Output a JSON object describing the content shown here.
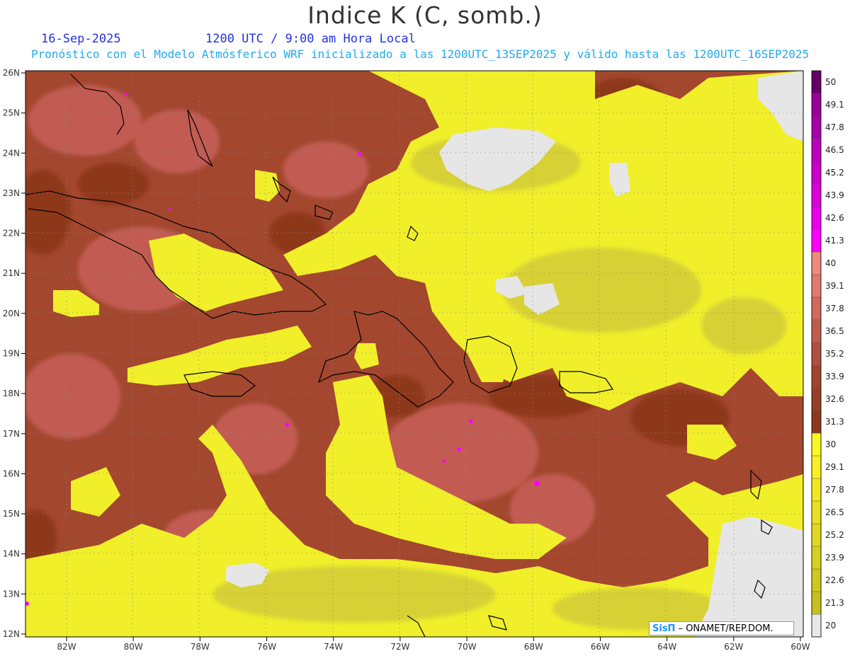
{
  "title": "Indice K (C, somb.)",
  "date": "16-Sep-2025",
  "time_label": "1200 UTC / 9:00 am Hora Local",
  "description": "Pronóstico con el Modelo Atmósferico WRF inicializado a las 1200UTC_13SEP2025 y válido hasta las  1200UTC_16SEP2025",
  "credit": {
    "brand": "SisΠ",
    "text": " – ONAMET/REP.DOM."
  },
  "lat_labels": [
    "12N",
    "13N",
    "14N",
    "15N",
    "16N",
    "17N",
    "18N",
    "19N",
    "20N",
    "21N",
    "22N",
    "23N",
    "24N",
    "25N",
    "26N"
  ],
  "lon_labels": [
    "82W",
    "80W",
    "78W",
    "76W",
    "74W",
    "72W",
    "70W",
    "68W",
    "66W",
    "64W",
    "62W",
    "60W"
  ],
  "colorbar": {
    "labels": [
      "20",
      "21.3",
      "22.6",
      "23.9",
      "25.2",
      "26.5",
      "27.8",
      "29.1",
      "30",
      "31.3",
      "32.6",
      "33.9",
      "35.2",
      "36.5",
      "37.8",
      "39.1",
      "40",
      "41.3",
      "42.6",
      "43.9",
      "45.2",
      "46.5",
      "47.8",
      "49.1",
      "50"
    ],
    "colors": [
      "#e8e8e8",
      "#c8c020",
      "#d0c820",
      "#d8d020",
      "#e0d820",
      "#e8e020",
      "#f0e820",
      "#f8f020",
      "#f8f820",
      "#8b3a1a",
      "#963f22",
      "#a0462c",
      "#b05040",
      "#c05c4c",
      "#d06a5c",
      "#e07a6c",
      "#ee8a7c",
      "#ff00ff",
      "#ee00ee",
      "#dd00dd",
      "#cc00cc",
      "#bb00bb",
      "#aa00aa",
      "#990099",
      "#660066"
    ]
  },
  "colors": {
    "brown": "#a3472f",
    "dark_brown": "#8a3418",
    "light_brown": "#c8605a",
    "yellow": "#f0ef2a",
    "olive": "#cfc83a",
    "gray": "#e6e6e6"
  }
}
